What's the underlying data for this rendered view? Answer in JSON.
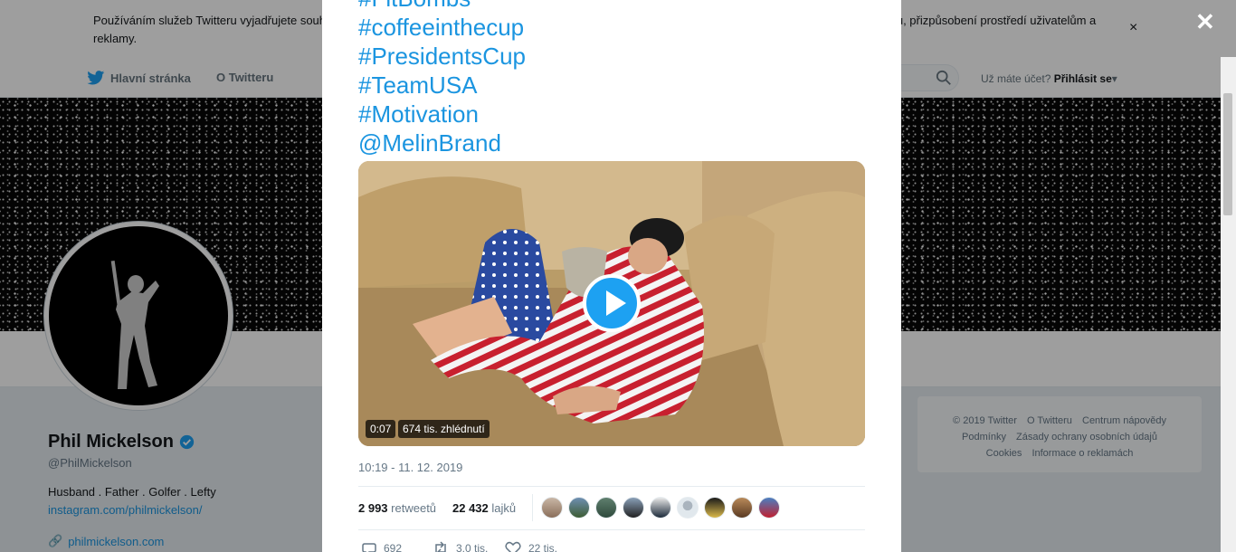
{
  "cookie_banner": {
    "text": "Používáním služeb Twitteru vyjadřujete souhlas s naším používáním souborů cookie. My i naši partneři působíme globálně a používáme cookie pro analýzu, přizpůsobení prostředí uživatelům a reklamy.",
    "close": "×"
  },
  "nav": {
    "home": "Hlavní stránka",
    "about": "O Twitteru",
    "login_prompt": "Už máte účet?",
    "login": "Přihlásit se"
  },
  "profile": {
    "name": "Phil Mickelson",
    "handle": "@PhilMickelson",
    "bio": "Husband . Father . Golfer . Lefty",
    "instagram": "instagram.com/philmickelson/",
    "website": "philmickelson.com"
  },
  "footer": {
    "links": [
      "© 2019 Twitter",
      "O Twitteru",
      "Centrum nápovědy",
      "Podmínky",
      "Zásady ochrany osobních údajů",
      "Cookies",
      "Informace o reklamách"
    ]
  },
  "tweet": {
    "hashtags": [
      "#FitBombs",
      "#coffeeinthecup",
      "#PresidentsCup",
      "#TeamUSA",
      "#Motivation",
      "@MelinBrand"
    ],
    "video_time": "0:07",
    "video_views": "674 tis. zhlédnutí",
    "timestamp": "10:19 - 11. 12. 2019",
    "retweets_count": "2 993",
    "retweets_label": "retweetů",
    "likes_count": "22 432",
    "likes_label": "lajků",
    "reply_count": "692",
    "retweet_action_count": "3,0 tis.",
    "like_action_count": "22 tis."
  },
  "overlay": {
    "close": "✕"
  },
  "colors": {
    "twitter_blue": "#1da1f2",
    "link": "#1b95e0"
  }
}
